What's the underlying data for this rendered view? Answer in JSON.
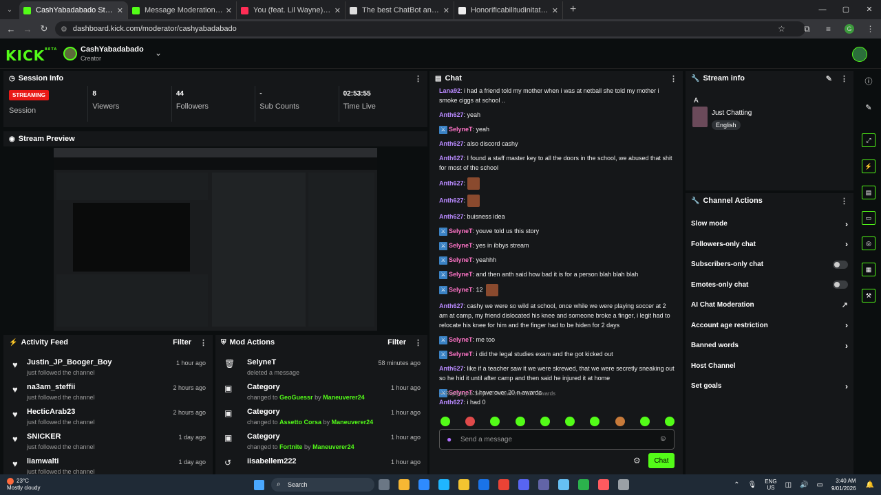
{
  "browser": {
    "tabs": [
      {
        "title": "CashYabadabado Stream - Kick",
        "color": "#53fc18",
        "active": true
      },
      {
        "title": "Message Moderation - Kick Da",
        "color": "#53fc18",
        "active": false
      },
      {
        "title": "You (feat. Lil Wayne) - YouT",
        "color": "#ff2d55",
        "active": false
      },
      {
        "title": "The best ChatBot and Widgets",
        "color": "#dddddd",
        "active": false
      },
      {
        "title": "Honorificabilitudinitatibus - Go",
        "color": "#eeeeee",
        "active": false
      }
    ],
    "url": "dashboard.kick.com/moderator/cashyabadabado",
    "profile_letter": "G"
  },
  "header": {
    "logo": "KICK",
    "logo_sup": "BETA",
    "channel_name": "CashYabadabado",
    "channel_role": "Creator"
  },
  "session": {
    "title": "Session Info",
    "live_badge": "STREAMING",
    "session_label": "Session",
    "stats": [
      {
        "value": "8",
        "label": "Viewers"
      },
      {
        "value": "44",
        "label": "Followers"
      },
      {
        "value": "-",
        "label": "Sub Counts"
      },
      {
        "value": "02:53:55",
        "label": "Time Live"
      }
    ]
  },
  "preview": {
    "title": "Stream Preview"
  },
  "activity": {
    "title": "Activity Feed",
    "filter": "Filter",
    "items": [
      {
        "name": "Justin_JP_Booger_Boy",
        "sub": "just followed the channel",
        "time": "1 hour ago"
      },
      {
        "name": "na3am_steffii",
        "sub": "just followed the channel",
        "time": "2 hours ago"
      },
      {
        "name": "HecticArab23",
        "sub": "just followed the channel",
        "time": "2 hours ago"
      },
      {
        "name": "SNICKER",
        "sub": "just followed the channel",
        "time": "1 day ago"
      },
      {
        "name": "liamwalti",
        "sub": "just followed the channel",
        "time": "1 day ago"
      }
    ]
  },
  "mod_actions": {
    "title": "Mod Actions",
    "filter": "Filter",
    "items": [
      {
        "name": "SelyneT",
        "pre": "deleted a message",
        "val": "",
        "mid": "",
        "by": "",
        "time": "58 minutes ago",
        "icon": "trash-icon"
      },
      {
        "name": "Category",
        "pre": "changed to ",
        "val": "GeoGuessr",
        "mid": " by ",
        "by": "Maneuverer24",
        "time": "1 hour ago",
        "icon": "category-icon"
      },
      {
        "name": "Category",
        "pre": "changed to ",
        "val": "Assetto Corsa",
        "mid": " by ",
        "by": "Maneuverer24",
        "time": "1 hour ago",
        "icon": "category-icon"
      },
      {
        "name": "Category",
        "pre": "changed to ",
        "val": "Fortnite",
        "mid": " by ",
        "by": "Maneuverer24",
        "time": "1 hour ago",
        "icon": "category-icon"
      },
      {
        "name": "iisabellem222",
        "pre": "",
        "val": "",
        "mid": "",
        "by": "",
        "time": "1 hour ago",
        "icon": "undo-icon"
      }
    ]
  },
  "chat": {
    "title": "Chat",
    "messages": [
      {
        "user": "Lana92",
        "color": "purple",
        "badge": false,
        "text": "i had a friend told my mother when i was at netball she told my mother i smoke ciggs at school ..",
        "emote": false
      },
      {
        "user": "Anth627",
        "color": "purple",
        "badge": false,
        "text": "yeah",
        "emote": false
      },
      {
        "user": "SelyneT",
        "color": "pink",
        "badge": true,
        "text": "yeah",
        "emote": false
      },
      {
        "user": "Anth627",
        "color": "purple",
        "badge": false,
        "text": "also discord cashy",
        "emote": false
      },
      {
        "user": "Anth627",
        "color": "purple",
        "badge": false,
        "text": "I found a staff master key to all the doors in the school, we abused that shit for most of the school",
        "emote": false
      },
      {
        "user": "Anth627",
        "color": "purple",
        "badge": false,
        "text": "",
        "emote": true
      },
      {
        "user": "Anth627",
        "color": "purple",
        "badge": false,
        "text": "",
        "emote": true
      },
      {
        "user": "Anth627",
        "color": "purple",
        "badge": false,
        "text": "buisness idea",
        "emote": false
      },
      {
        "user": "SelyneT",
        "color": "pink",
        "badge": true,
        "text": "youve told us this story",
        "emote": false
      },
      {
        "user": "SelyneT",
        "color": "pink",
        "badge": true,
        "text": "yes in ibbys stream",
        "emote": false
      },
      {
        "user": "SelyneT",
        "color": "pink",
        "badge": true,
        "text": "yeahhh",
        "emote": false
      },
      {
        "user": "SelyneT",
        "color": "pink",
        "badge": true,
        "text": "and then anth said how bad it is for a person blah blah blah",
        "emote": false
      },
      {
        "user": "SelyneT",
        "color": "pink",
        "badge": true,
        "text": "12",
        "emote": true
      },
      {
        "user": "Anth627",
        "color": "purple",
        "badge": false,
        "text": "cashy we were so wild at school, once while we were playing soccer at 2 am at camp, my friend dislocated his knee and someone broke a finger, i legit had to relocate his knee for him and the finger had to be hiden for 2 days",
        "emote": false
      },
      {
        "user": "SelyneT",
        "color": "pink",
        "badge": true,
        "text": "me too",
        "emote": false
      },
      {
        "user": "SelyneT",
        "color": "pink",
        "badge": true,
        "text": "i did the legal studies exam and the got kicked out",
        "emote": false
      },
      {
        "user": "Anth627",
        "color": "purple",
        "badge": false,
        "text": "like if a teacher saw it we were skrewed, that we were secretly sneaking out so he hid it until after camp and then said he injured it at home",
        "emote": false
      },
      {
        "user": "SelyneT",
        "color": "pink",
        "badge": true,
        "text": "i have over 20 n awards",
        "emote": false
      }
    ],
    "reply_to": "Replying to SelyneT: i have over 20 n awards",
    "last_user": "Anth627",
    "last_text": "i had 0",
    "placeholder": "Send a message",
    "send": "Chat"
  },
  "stream_info": {
    "title": "Stream info",
    "letter": "A",
    "category": "Just Chatting",
    "language": "English"
  },
  "channel_actions": {
    "title": "Channel Actions",
    "items": [
      {
        "label": "Slow mode",
        "control": "chevron"
      },
      {
        "label": "Followers-only chat",
        "control": "chevron"
      },
      {
        "label": "Subscribers-only chat",
        "control": "toggle"
      },
      {
        "label": "Emotes-only chat",
        "control": "toggle"
      },
      {
        "label": "AI Chat Moderation",
        "control": "external"
      },
      {
        "label": "Account age restriction",
        "control": "chevron"
      },
      {
        "label": "Banned words",
        "control": "chevron"
      },
      {
        "label": "Host Channel",
        "control": "none"
      },
      {
        "label": "Set goals",
        "control": "chevron"
      }
    ]
  },
  "taskbar": {
    "temp": "23°C",
    "weather": "Mostly cloudy",
    "search": "Search",
    "lang1": "ENG",
    "lang2": "US",
    "time": "3:40 AM",
    "date": "9/01/2026",
    "apps": [
      "#6b7785",
      "#f7b733",
      "#2e8bff",
      "#1fb6ff",
      "#f4c430",
      "#1a73e8",
      "#ea4335",
      "#5865f2",
      "#6264a7",
      "#66c0f4",
      "#2bb24c",
      "#ff5a5f",
      "#9aa0a6"
    ]
  }
}
